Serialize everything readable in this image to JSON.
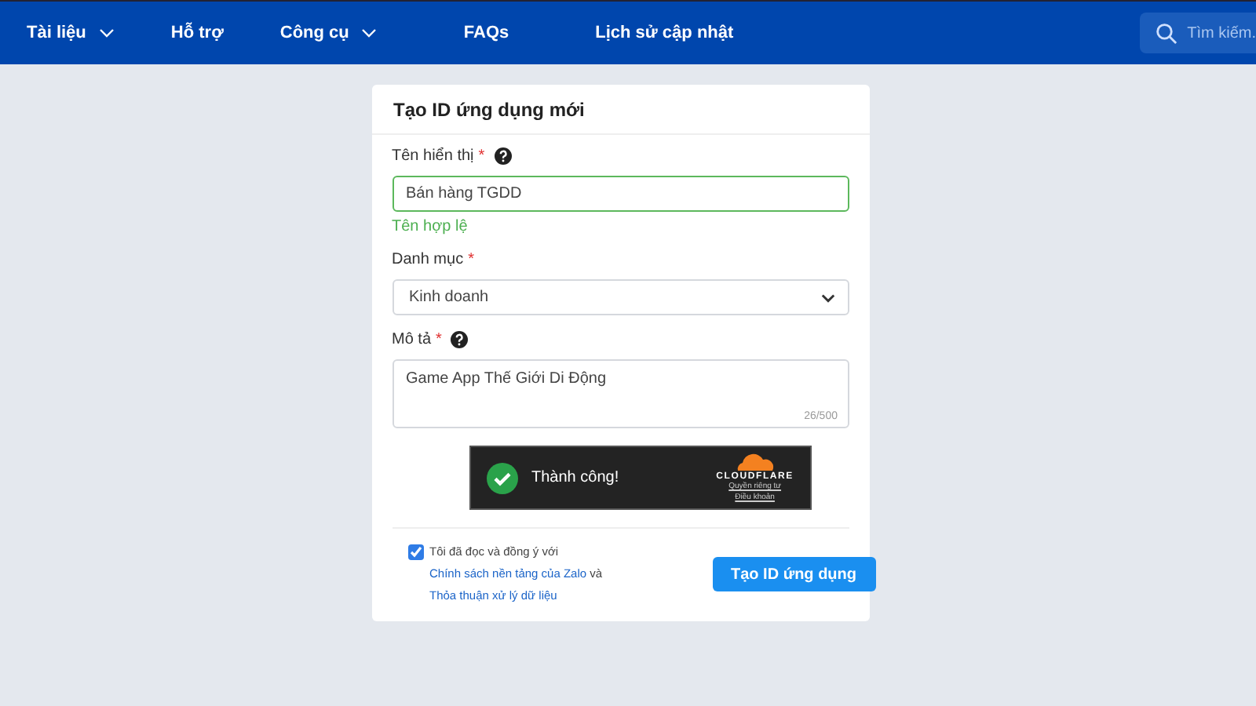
{
  "nav": {
    "items": [
      {
        "label": "Tài liệu",
        "dropdown": true
      },
      {
        "label": "Hỗ trợ",
        "dropdown": false
      },
      {
        "label": "Công cụ",
        "dropdown": true
      },
      {
        "label": "FAQs",
        "dropdown": false
      },
      {
        "label": "Lịch sử cập nhật",
        "dropdown": false
      }
    ],
    "search": {
      "placeholder": "Tìm kiếm."
    }
  },
  "form": {
    "title": "Tạo ID ứng dụng mới",
    "fields": [
      {
        "kind": "text",
        "label": "Tên hiển thị",
        "required": "*",
        "help": true,
        "value": "Bán hàng TGDD",
        "valid": true,
        "message": "Tên hợp lệ"
      },
      {
        "kind": "select",
        "label": "Danh mục",
        "required": "*",
        "value": "Kinh doanh"
      },
      {
        "kind": "textarea",
        "label": "Mô tả",
        "required": "*",
        "help": true,
        "value": "Game App Thế Giới Di Động",
        "counter": "26/500"
      }
    ],
    "captcha": {
      "status": "Thành công!",
      "brand": "CLOUDFLARE",
      "links": [
        "Quyền riêng tư",
        "Điều khoản"
      ]
    },
    "agreement": {
      "checked": true,
      "parts": [
        {
          "kind": "text",
          "text": "Tôi đã đọc và đồng ý với "
        },
        {
          "kind": "link",
          "text": "Chính sách nền tảng của Zalo"
        },
        {
          "kind": "text",
          "text": " và "
        },
        {
          "kind": "link",
          "text": "Thỏa thuận xử lý dữ liệu"
        }
      ]
    },
    "submit": "Tạo ID ứng dụng"
  }
}
